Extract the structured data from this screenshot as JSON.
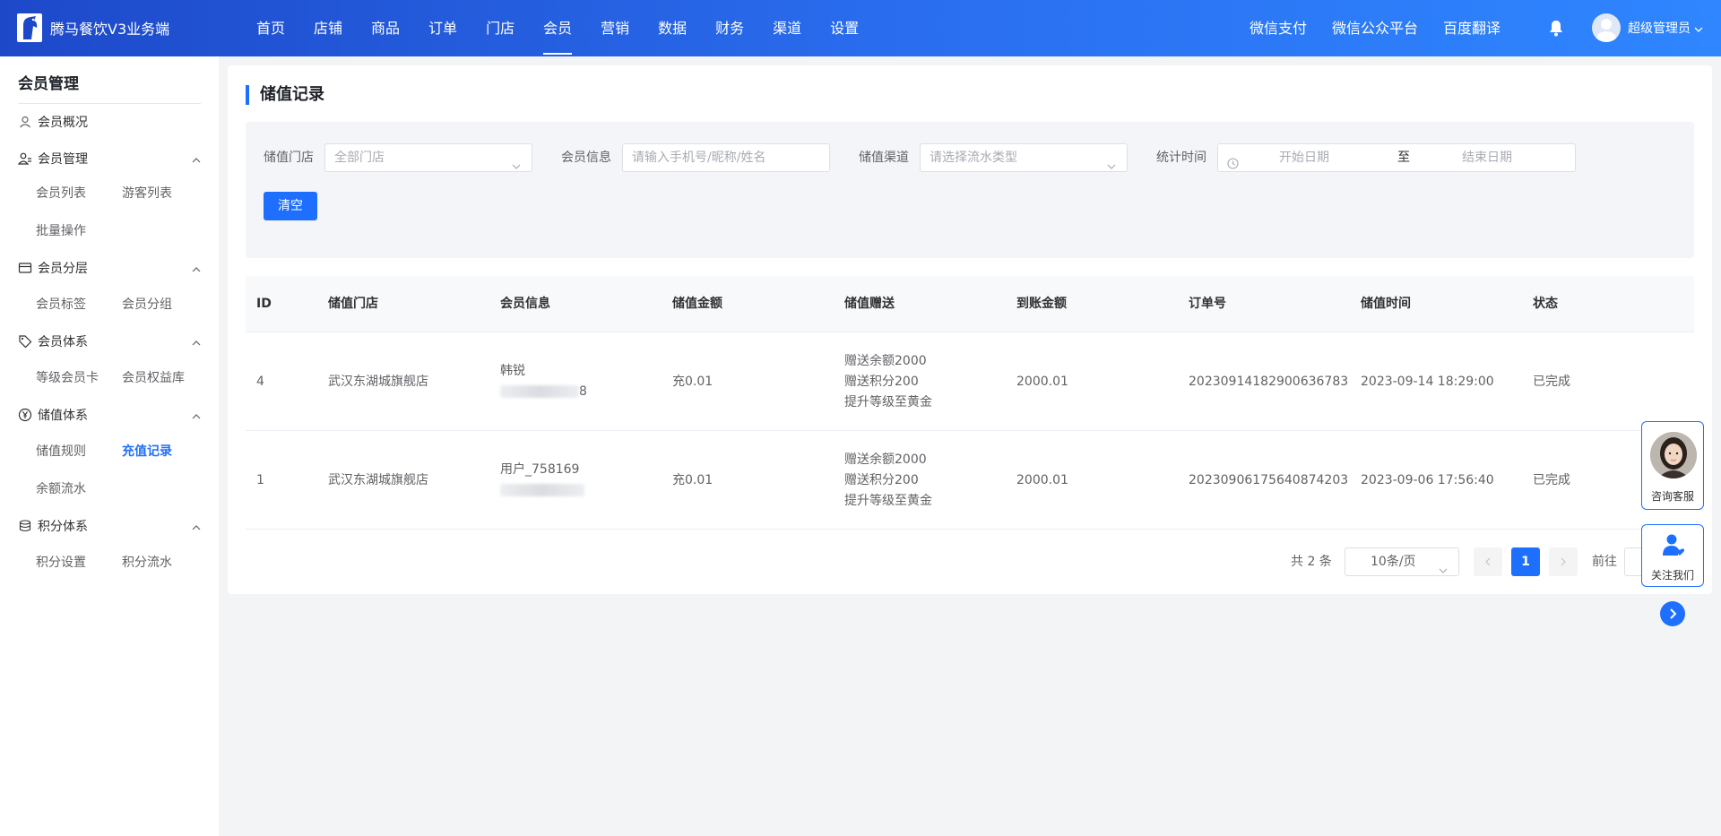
{
  "app": {
    "title": "腾马餐饮V3业务端"
  },
  "nav": [
    {
      "label": "首页",
      "active": false
    },
    {
      "label": "店铺",
      "active": false
    },
    {
      "label": "商品",
      "active": false
    },
    {
      "label": "订单",
      "active": false
    },
    {
      "label": "门店",
      "active": false
    },
    {
      "label": "会员",
      "active": true
    },
    {
      "label": "营销",
      "active": false
    },
    {
      "label": "数据",
      "active": false
    },
    {
      "label": "财务",
      "active": false
    },
    {
      "label": "渠道",
      "active": false
    },
    {
      "label": "设置",
      "active": false
    }
  ],
  "top_links": [
    "微信支付",
    "微信公众平台",
    "百度翻译"
  ],
  "user": {
    "name": "超级管理员"
  },
  "sidebar": {
    "title": "会员管理",
    "overview": "会员概况",
    "groups": [
      {
        "label": "会员管理",
        "icon": "member-manage-icon",
        "items": [
          "会员列表",
          "游客列表",
          "批量操作"
        ]
      },
      {
        "label": "会员分层",
        "icon": "card-icon",
        "items": [
          "会员标签",
          "会员分组"
        ]
      },
      {
        "label": "会员体系",
        "icon": "tag-icon",
        "items": [
          "等级会员卡",
          "会员权益库"
        ]
      },
      {
        "label": "储值体系",
        "icon": "yen-icon",
        "items": [
          "储值规则",
          "充值记录",
          "余额流水"
        ]
      },
      {
        "label": "积分体系",
        "icon": "coins-icon",
        "items": [
          "积分设置",
          "积分流水"
        ]
      }
    ],
    "active_item": "充值记录"
  },
  "page": {
    "title": "储值记录"
  },
  "filter": {
    "store_label": "储值门店",
    "store_placeholder": "全部门店",
    "member_label": "会员信息",
    "member_placeholder": "请输入手机号/昵称/姓名",
    "channel_label": "储值渠道",
    "channel_placeholder": "请选择流水类型",
    "time_label": "统计时间",
    "start_placeholder": "开始日期",
    "separator": "至",
    "end_placeholder": "结束日期",
    "clear_label": "清空"
  },
  "table": {
    "headers": [
      "ID",
      "储值门店",
      "会员信息",
      "储值金额",
      "储值赠送",
      "到账金额",
      "订单号",
      "储值时间",
      "状态"
    ],
    "rows": [
      {
        "id": "4",
        "store": "武汉东湖城旗舰店",
        "member_name": "韩锐",
        "member_phone_tail": "8",
        "amount": "充0.01",
        "gifts": [
          "赠送余额2000",
          "赠送积分200",
          "提升等级至黄金"
        ],
        "received": "2000.01",
        "order_no": "20230914182900636783",
        "time": "2023-09-14 18:29:00",
        "status": "已完成"
      },
      {
        "id": "1",
        "store": "武汉东湖城旗舰店",
        "member_name": "用户_758169",
        "member_phone_tail": "",
        "amount": "充0.01",
        "gifts": [
          "赠送余额2000",
          "赠送积分200",
          "提升等级至黄金"
        ],
        "received": "2000.01",
        "order_no": "20230906175640874203",
        "time": "2023-09-06 17:56:40",
        "status": "已完成"
      }
    ]
  },
  "pagination": {
    "total": "共 2 条",
    "page_size": "10条/页",
    "current": "1",
    "goto": "前往"
  },
  "float": {
    "service": "咨询客服",
    "follow": "关注我们"
  },
  "colors": {
    "primary": "#1f6fff",
    "topbar_start": "#1d49c9",
    "topbar_end": "#2f86ff"
  }
}
